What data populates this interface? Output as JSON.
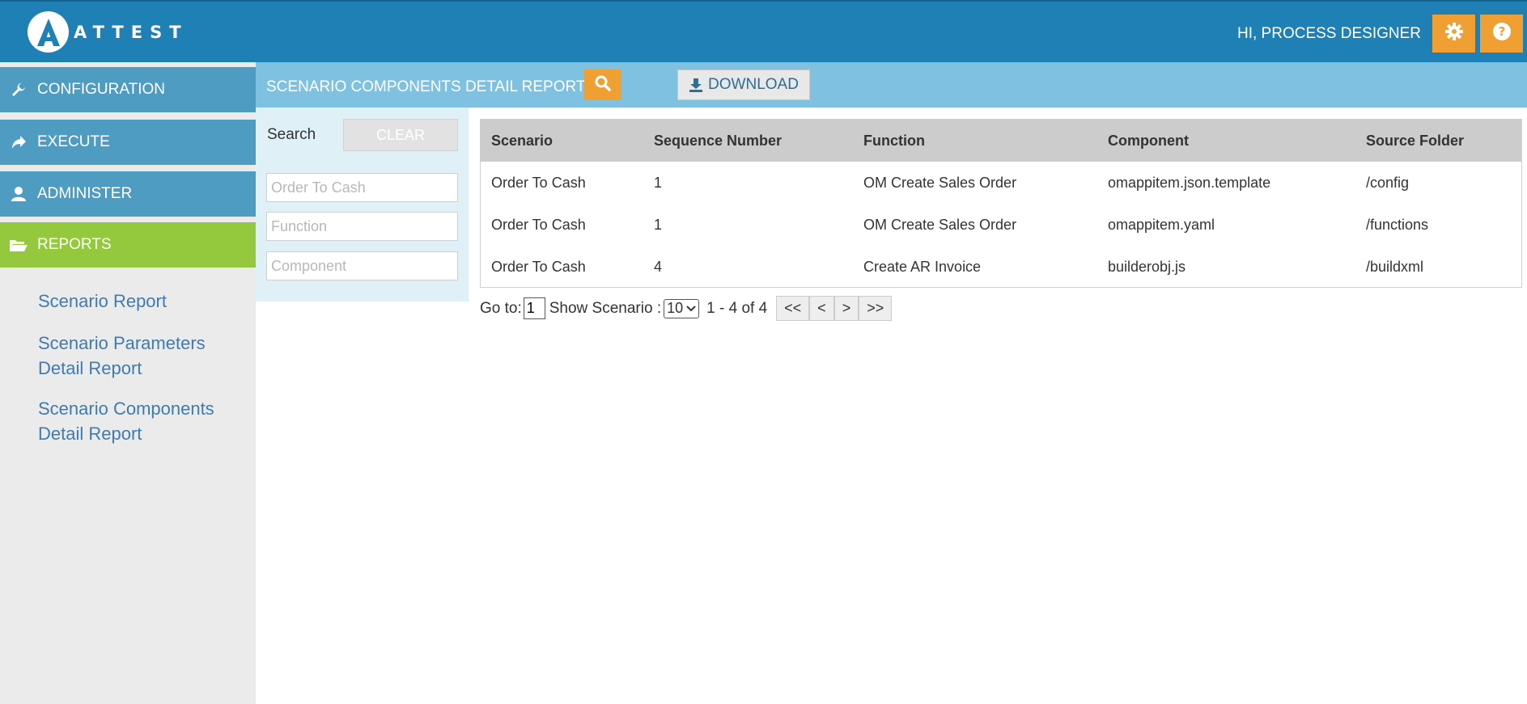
{
  "app": {
    "logo_text": "ATTEST",
    "greeting": "HI, PROCESS DESIGNER",
    "colors": {
      "primary": "#1f80b5",
      "accent": "#f0a033",
      "active_nav": "#94c83d",
      "nav": "#4f9cc3"
    }
  },
  "sidebar": {
    "items": [
      {
        "label": "CONFIGURATION",
        "icon": "wrench-icon"
      },
      {
        "label": "EXECUTE",
        "icon": "share-arrow-icon"
      },
      {
        "label": "ADMINISTER",
        "icon": "user-icon"
      },
      {
        "label": "REPORTS",
        "icon": "folder-open-icon",
        "active": true
      }
    ],
    "reports": [
      {
        "label": "Scenario Report"
      },
      {
        "label": "Scenario Parameters Detail Report"
      },
      {
        "label": "Scenario Components Detail Report"
      }
    ]
  },
  "header": {
    "title": "SCENARIO COMPONENTS DETAIL REPORT",
    "download_label": "DOWNLOAD"
  },
  "filters": {
    "search_label": "Search",
    "clear_label": "CLEAR",
    "scenario_value": "Order To Cash",
    "function_placeholder": "Function",
    "component_placeholder": "Component"
  },
  "table": {
    "columns": [
      "Scenario",
      "Sequence Number",
      "Function",
      "Component",
      "Source Folder"
    ],
    "rows": [
      [
        "Order To Cash",
        "1",
        "OM Create Sales Order",
        "omappitem.json.template",
        "/config"
      ],
      [
        "Order To Cash",
        "1",
        "OM Create Sales Order",
        "omappitem.yaml",
        "/functions"
      ],
      [
        "Order To Cash",
        "4",
        "Create AR Invoice",
        "builderobj.js",
        "/buildxml"
      ]
    ]
  },
  "pager": {
    "goto_label": "Go to:",
    "goto_value": "1",
    "show_label": "Show Scenario :",
    "page_size": "10",
    "range_text": "1 - 4 of 4",
    "first": "<<",
    "prev": "<",
    "next": ">",
    "last": ">>"
  }
}
